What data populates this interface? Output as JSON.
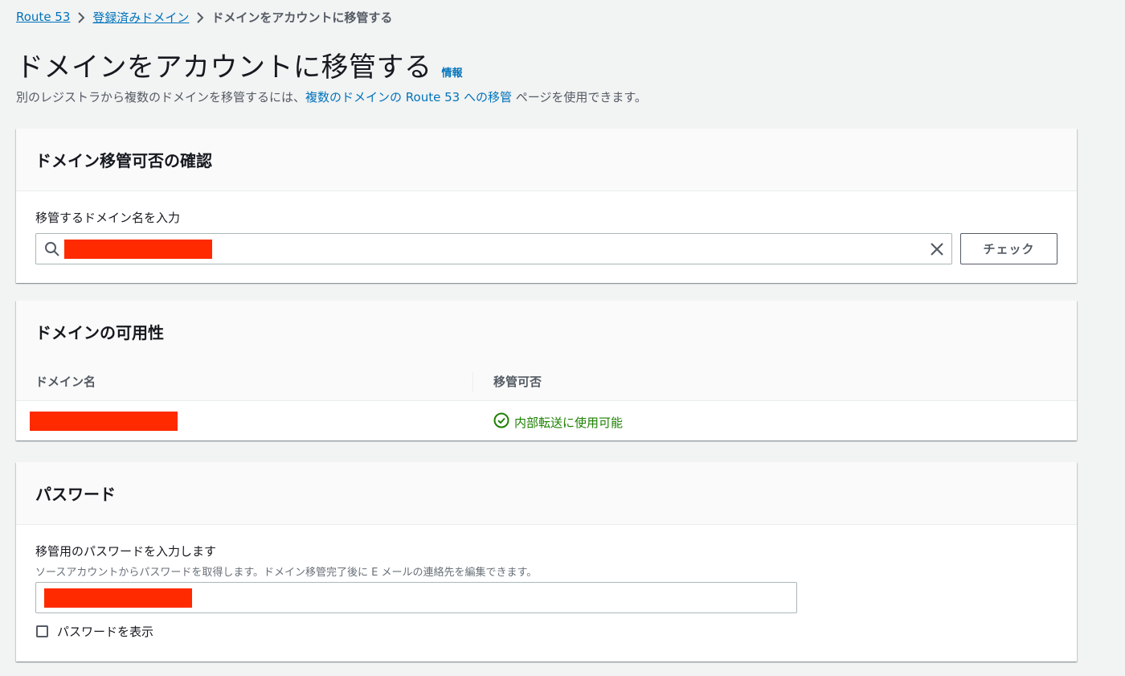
{
  "breadcrumb": {
    "items": [
      "Route 53",
      "登録済みドメイン"
    ],
    "current": "ドメインをアカウントに移管する"
  },
  "page": {
    "title": "ドメインをアカウントに移管する",
    "info_link": "情報",
    "subtitle_before": "別のレジストラから複数のドメインを移管するには、",
    "subtitle_link": "複数のドメインの Route 53 への移管",
    "subtitle_after": " ページを使用できます。"
  },
  "check_panel": {
    "title": "ドメイン移管可否の確認",
    "input_label": "移管するドメイン名を入力",
    "check_button": "チェック"
  },
  "availability_panel": {
    "title": "ドメインの可用性",
    "columns": [
      "ドメイン名",
      "移管可否"
    ],
    "rows": [
      {
        "status": "内部転送に使用可能"
      }
    ]
  },
  "password_panel": {
    "title": "パスワード",
    "input_label": "移管用のパスワードを入力します",
    "input_description": "ソースアカウントからパスワードを取得します。ドメイン移管完了後に E メールの連絡先を編集できます。",
    "show_password_label": "パスワードを表示",
    "show_password_checked": false
  },
  "colors": {
    "link": "#0073bb",
    "success": "#1d8102",
    "redaction": "#ff2a00",
    "background": "#f2f3f3"
  },
  "icons": [
    "chevron-right-icon",
    "search-icon",
    "clear-icon",
    "status-success-icon"
  ]
}
